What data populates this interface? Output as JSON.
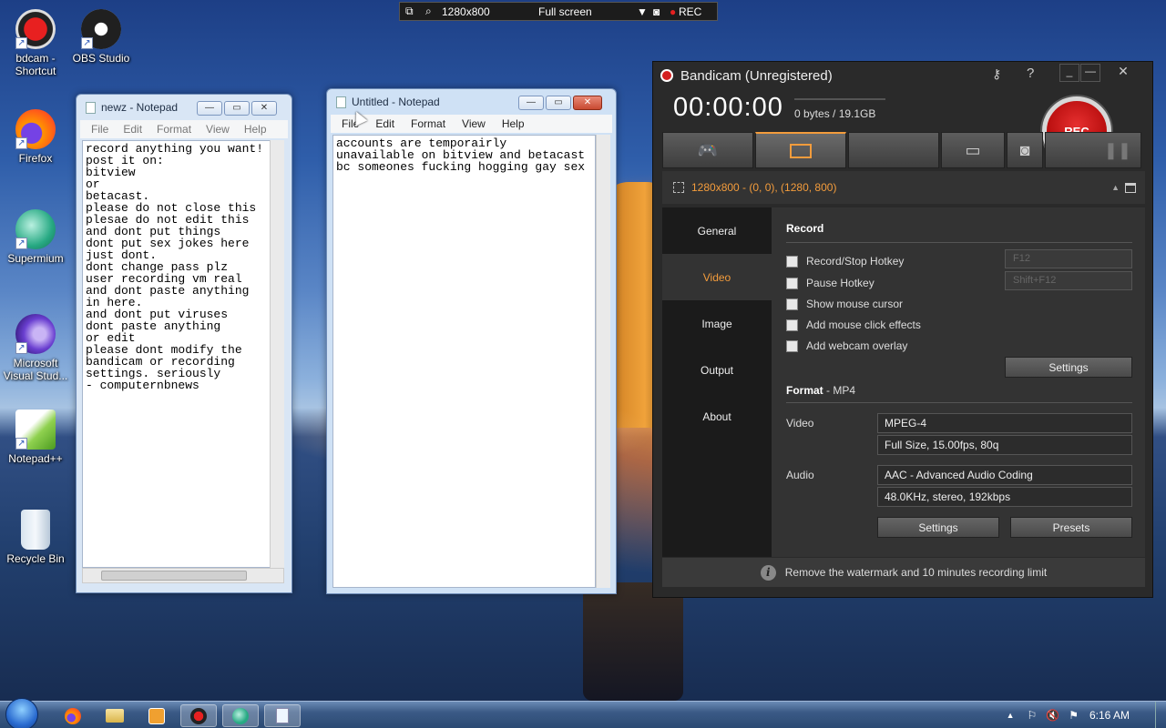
{
  "desktop": {
    "icons": [
      {
        "label": "bdcam - Shortcut",
        "icon": "bandicam-icon"
      },
      {
        "label": "OBS Studio",
        "icon": "obs-icon"
      },
      {
        "label": "Firefox",
        "icon": "firefox-icon"
      },
      {
        "label": "Supermium",
        "icon": "supermium-icon"
      },
      {
        "label": "Microsoft Visual Stud...",
        "icon": "visual-studio-icon"
      },
      {
        "label": "Notepad++",
        "icon": "notepadpp-icon"
      },
      {
        "label": "Recycle Bin",
        "icon": "recycle-bin-icon"
      }
    ]
  },
  "recbar": {
    "resolution": "1280x800",
    "mode": "Full screen",
    "rec_label": "REC"
  },
  "notepad1": {
    "title": "newz - Notepad",
    "menu": [
      "File",
      "Edit",
      "Format",
      "View",
      "Help"
    ],
    "text": "record anything you want!\npost it on:\nbitview\nor\nbetacast.\nplease do not close this\nplesae do not edit this\nand dont put things\ndont put sex jokes here\njust dont.\ndont change pass plz\nuser recording vm real\nand dont paste anything\nin here.\nand dont put viruses\ndont paste anything\nor edit\nplease dont modify the\nbandicam or recording\nsettings. seriously\n- computernbnews"
  },
  "notepad2": {
    "title": "Untitled - Notepad",
    "menu": [
      "File",
      "Edit",
      "Format",
      "View",
      "Help"
    ],
    "text": "accounts are temporairly\nunavailable on bitview and betacast\nbc someones fucking hogging gay sex"
  },
  "bandicam": {
    "title": "Bandicam (Unregistered)",
    "timer": "00:00:00",
    "bytes": "0 bytes / 19.1GB",
    "rec_button": "REC",
    "area": "1280x800 - (0, 0), (1280, 800)",
    "sidebar": [
      "General",
      "Video",
      "Image",
      "Output",
      "About"
    ],
    "record_heading": "Record",
    "options": [
      "Record/Stop Hotkey",
      "Pause Hotkey",
      "Show mouse cursor",
      "Add mouse click effects",
      "Add webcam overlay"
    ],
    "hotkey1": "F12",
    "hotkey2": "Shift+F12",
    "settings_label": "Settings",
    "format_heading": "Format",
    "format_value": " - MP4",
    "video_label": "Video",
    "video_codec": "MPEG-4",
    "video_details": "Full Size, 15.00fps, 80q",
    "audio_label": "Audio",
    "audio_codec": "AAC - Advanced Audio Coding",
    "audio_details": "48.0KHz, stereo, 192kbps",
    "presets_label": "Presets",
    "footer": "Remove the watermark and 10 minutes recording limit",
    "help_glyph": "?"
  },
  "taskbar": {
    "clock": "6:16 AM"
  }
}
